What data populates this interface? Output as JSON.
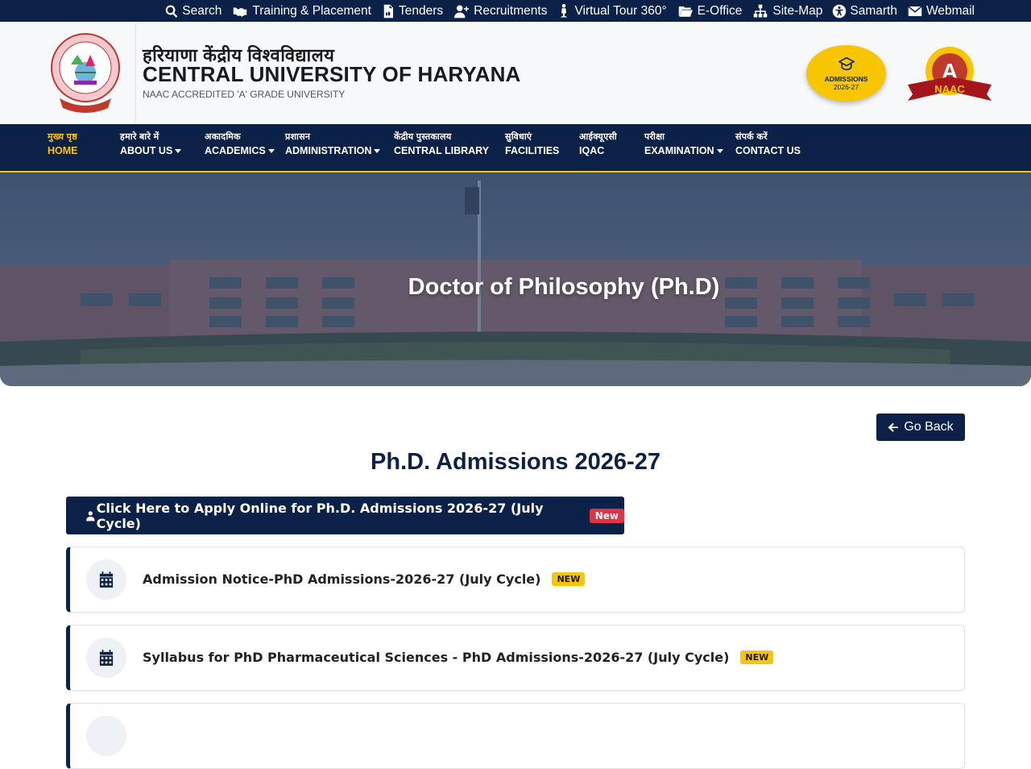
{
  "topbar": {
    "items": [
      {
        "label": "Search",
        "icon": "search-icon"
      },
      {
        "label": "Training & Placement",
        "icon": "handshake-icon"
      },
      {
        "label": "Tenders",
        "icon": "file-pdf-icon"
      },
      {
        "label": "Recruitments",
        "icon": "user-plus-icon"
      },
      {
        "label": "Virtual Tour 360°",
        "icon": "person-walking-icon"
      },
      {
        "label": "E-Office",
        "icon": "folder-open-icon"
      },
      {
        "label": "Site-Map",
        "icon": "sitemap-icon"
      },
      {
        "label": "Samarth",
        "icon": "accessibility-icon"
      },
      {
        "label": "Webmail",
        "icon": "envelope-icon"
      }
    ]
  },
  "header": {
    "hindi_title": "हरियाणा केंद्रीय विश्वविद्यालय",
    "title": "CENTRAL UNIVERSITY OF HARYANA",
    "subtitle": "NAAC ACCREDITED 'A' GRADE UNIVERSITY",
    "admission_badge": {
      "line1": "ADMISSIONS",
      "line2": "2026-27"
    },
    "naac": {
      "grade": "A",
      "label": "NAAC"
    }
  },
  "nav": {
    "items": [
      {
        "hi": "मुख्य पृष्ठ",
        "en": "HOME",
        "dropdown": false
      },
      {
        "hi": "हमारे बारे में",
        "en": "ABOUT US",
        "dropdown": true
      },
      {
        "hi": "अकादमिक",
        "en": "ACADEMICS",
        "dropdown": true
      },
      {
        "hi": "प्रशासन",
        "en": "ADMINISTRATION",
        "dropdown": true
      },
      {
        "hi": "केंद्रीय पुस्तकालय",
        "en": "CENTRAL LIBRARY",
        "dropdown": false
      },
      {
        "hi": "सुविधाएं",
        "en": "FACILITIES",
        "dropdown": false
      },
      {
        "hi": "आईक्यूएसी",
        "en": "IQAC",
        "dropdown": false
      },
      {
        "hi": "परीक्षा",
        "en": "EXAMINATION",
        "dropdown": true
      },
      {
        "hi": "संपर्क करें",
        "en": "CONTACT US",
        "dropdown": false
      }
    ]
  },
  "banner": {
    "title": "Doctor of Philosophy (Ph.D)"
  },
  "main": {
    "go_back": "Go Back",
    "page_title": "Ph.D. Admissions 2026-27",
    "apply_label": "Click Here to Apply Online for Ph.D. Admissions 2026-27 (July Cycle)",
    "apply_badge": "New",
    "cards": [
      {
        "label": "Admission Notice-PhD Admissions-2026-27 (July Cycle)",
        "badge": "NEW"
      },
      {
        "label": "Syllabus for PhD Pharmaceutical Sciences - PhD Admissions-2026-27 (July Cycle)",
        "badge": "NEW"
      }
    ]
  },
  "colors": {
    "primary": "#0b2147",
    "accent": "#f7c600",
    "danger": "#dc3545"
  }
}
